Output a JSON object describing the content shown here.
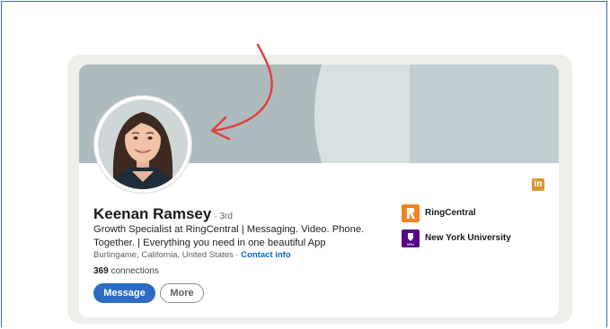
{
  "profile": {
    "name": "Keenan Ramsey",
    "degree": "· 3rd",
    "headline": "Growth Specialist at RingCentral | Messaging. Video. Phone. Together. | Everything you need in one beautiful App",
    "location": "Burlingame, California, United States ·",
    "contact_info": "Contact info",
    "connections_count": "369",
    "connections_label": "connections"
  },
  "actions": {
    "message": "Message",
    "more": "More"
  },
  "experience": [
    {
      "name": "RingCentral",
      "logo_text": "R",
      "color": "#f58220"
    },
    {
      "name": "New York University",
      "logo_text": "NYU",
      "color": "#57068c"
    }
  ],
  "icons": {
    "linkedin": "in",
    "annotation": "red-hand-drawn-arrow"
  },
  "colors": {
    "accent": "#0a66c2",
    "annotation": "#e0403a",
    "linkedin_icon": "#d29a34"
  }
}
